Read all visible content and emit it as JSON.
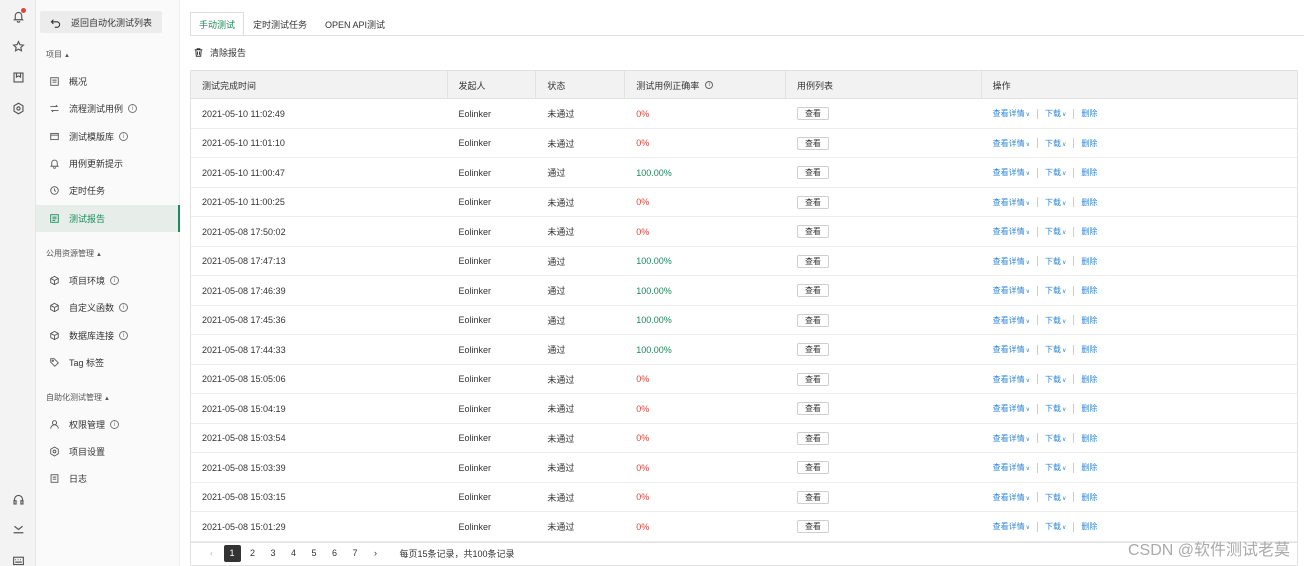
{
  "sidebar": {
    "back_label": "返回自动化测试列表",
    "groups": [
      {
        "label": "项目",
        "caret": "▲"
      },
      {
        "label": "公用资源管理",
        "caret": "▲"
      },
      {
        "label": "自助化测试管理",
        "caret": "▲"
      }
    ],
    "items": [
      {
        "label": "概况",
        "icon": "overview-icon"
      },
      {
        "label": "流程测试用例",
        "icon": "flow-icon",
        "info": true
      },
      {
        "label": "测试模版库",
        "icon": "folder-icon",
        "info": true
      },
      {
        "label": "用例更新提示",
        "icon": "bell-icon"
      },
      {
        "label": "定时任务",
        "icon": "clock-icon"
      },
      {
        "label": "测试报告",
        "icon": "report-icon",
        "active": true
      },
      {
        "label": "项目环境",
        "icon": "cube-icon",
        "info": true
      },
      {
        "label": "自定义函数",
        "icon": "cube-icon",
        "info": true
      },
      {
        "label": "数据库连接",
        "icon": "cube-icon",
        "info": true
      },
      {
        "label": "Tag 标签",
        "icon": "tag-icon"
      },
      {
        "label": "权限管理",
        "icon": "user-icon",
        "info": true
      },
      {
        "label": "项目设置",
        "icon": "gear-icon"
      },
      {
        "label": "日志",
        "icon": "log-icon"
      }
    ],
    "info_glyph": "i"
  },
  "tabs": [
    "手动测试",
    "定时测试任务",
    "OPEN API测试"
  ],
  "toolbar": {
    "clear_label": "清除报告"
  },
  "table": {
    "headers": [
      "测试完成时间",
      "发起人",
      "状态",
      "测试用例正确率",
      "用例列表",
      "操作"
    ],
    "header_info_glyph": "i",
    "view_label": "查看",
    "ops": {
      "detail": "查看详情",
      "download": "下载",
      "delete": "删除",
      "chevron": "∨"
    },
    "rows": [
      {
        "time": "2021-05-10 11:02:49",
        "user": "Eolinker",
        "status": "未通过",
        "rate": "0%",
        "pass": false
      },
      {
        "time": "2021-05-10 11:01:10",
        "user": "Eolinker",
        "status": "未通过",
        "rate": "0%",
        "pass": false
      },
      {
        "time": "2021-05-10 11:00:47",
        "user": "Eolinker",
        "status": "通过",
        "rate": "100.00%",
        "pass": true
      },
      {
        "time": "2021-05-10 11:00:25",
        "user": "Eolinker",
        "status": "未通过",
        "rate": "0%",
        "pass": false
      },
      {
        "time": "2021-05-08 17:50:02",
        "user": "Eolinker",
        "status": "未通过",
        "rate": "0%",
        "pass": false
      },
      {
        "time": "2021-05-08 17:47:13",
        "user": "Eolinker",
        "status": "通过",
        "rate": "100.00%",
        "pass": true
      },
      {
        "time": "2021-05-08 17:46:39",
        "user": "Eolinker",
        "status": "通过",
        "rate": "100.00%",
        "pass": true
      },
      {
        "time": "2021-05-08 17:45:36",
        "user": "Eolinker",
        "status": "通过",
        "rate": "100.00%",
        "pass": true
      },
      {
        "time": "2021-05-08 17:44:33",
        "user": "Eolinker",
        "status": "通过",
        "rate": "100.00%",
        "pass": true
      },
      {
        "time": "2021-05-08 15:05:06",
        "user": "Eolinker",
        "status": "未通过",
        "rate": "0%",
        "pass": false
      },
      {
        "time": "2021-05-08 15:04:19",
        "user": "Eolinker",
        "status": "未通过",
        "rate": "0%",
        "pass": false
      },
      {
        "time": "2021-05-08 15:03:54",
        "user": "Eolinker",
        "status": "未通过",
        "rate": "0%",
        "pass": false
      },
      {
        "time": "2021-05-08 15:03:39",
        "user": "Eolinker",
        "status": "未通过",
        "rate": "0%",
        "pass": false
      },
      {
        "time": "2021-05-08 15:03:15",
        "user": "Eolinker",
        "status": "未通过",
        "rate": "0%",
        "pass": false
      },
      {
        "time": "2021-05-08 15:01:29",
        "user": "Eolinker",
        "status": "未通过",
        "rate": "0%",
        "pass": false
      }
    ]
  },
  "pagination": {
    "prev": "‹",
    "next": "›",
    "pages": [
      "1",
      "2",
      "3",
      "4",
      "5",
      "6",
      "7"
    ],
    "current": "1",
    "info": "每页15条记录，共100条记录"
  },
  "colors": {
    "accent": "#1b8a5a",
    "fail": "#e0433a",
    "link": "#2f86d8"
  },
  "watermark": "CSDN @软件测试老莫"
}
